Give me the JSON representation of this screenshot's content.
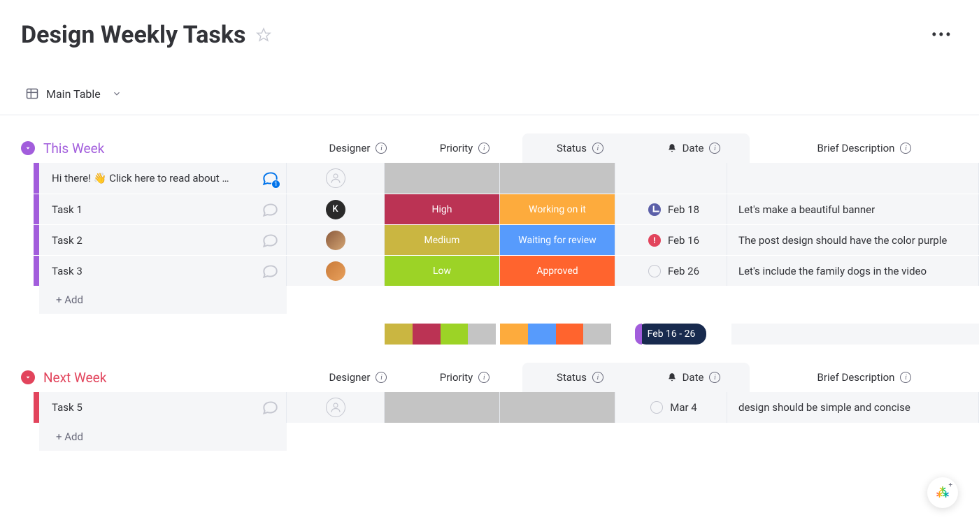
{
  "header": {
    "title": "Design Weekly Tasks"
  },
  "view": {
    "name": "Main Table"
  },
  "columns": {
    "designer": "Designer",
    "priority": "Priority",
    "status": "Status",
    "date": "Date",
    "description": "Brief Description"
  },
  "colors": {
    "priority": {
      "high": "#bb3354",
      "medium": "#cab641",
      "low": "#9cd326",
      "blank": "#c4c4c4"
    },
    "status": {
      "working": "#fdab3d",
      "waiting": "#579bfc",
      "approved": "#ff642e",
      "blank": "#c4c4c4"
    },
    "groups": {
      "thisWeek": "#a25ddc",
      "nextWeek": "#e2445c"
    }
  },
  "groups": [
    {
      "id": "thisWeek",
      "title": "This Week",
      "color": "#a25ddc",
      "summary": {
        "priority_segments": [
          "#cab641",
          "#bb3354",
          "#9cd326",
          "#c4c4c4"
        ],
        "status_segments": [
          "#fdab3d",
          "#579bfc",
          "#ff642e",
          "#c4c4c4"
        ],
        "date_range": "Feb 16 - 26"
      },
      "rows": [
        {
          "name": "Hi there! 👋 Click here to read about …",
          "chat": "active",
          "chat_count": "1",
          "designer": "empty",
          "priority": "",
          "priority_bg": "#c4c4c4",
          "status": "",
          "status_bg": "#c4c4c4",
          "date_icon": "",
          "date": "",
          "desc": ""
        },
        {
          "name": "Task 1",
          "chat": "idle",
          "designer": "k",
          "designer_initial": "K",
          "priority": "High",
          "priority_bg": "#bb3354",
          "status": "Working on it",
          "status_bg": "#fdab3d",
          "date_icon": "clock",
          "date": "Feb 18",
          "desc": "Let's make a beautiful banner"
        },
        {
          "name": "Task 2",
          "chat": "idle",
          "designer": "img1",
          "priority": "Medium",
          "priority_bg": "#cab641",
          "status": "Waiting for review",
          "status_bg": "#579bfc",
          "date_icon": "alert",
          "date": "Feb 16",
          "desc": "The post design should have the color purple"
        },
        {
          "name": "Task 3",
          "chat": "idle",
          "designer": "img2",
          "priority": "Low",
          "priority_bg": "#9cd326",
          "status": "Approved",
          "status_bg": "#ff642e",
          "date_icon": "circle",
          "date": "Feb 26",
          "desc": "Let's include the family dogs in the video"
        }
      ],
      "add_label": "+ Add"
    },
    {
      "id": "nextWeek",
      "title": "Next Week",
      "color": "#e2445c",
      "rows": [
        {
          "name": "Task 5",
          "chat": "idle",
          "designer": "empty",
          "priority": "",
          "priority_bg": "#c4c4c4",
          "status": "",
          "status_bg": "#c4c4c4",
          "date_icon": "circle",
          "date": "Mar 4",
          "desc": "design should be simple and concise"
        }
      ],
      "add_label": "+ Add"
    }
  ]
}
